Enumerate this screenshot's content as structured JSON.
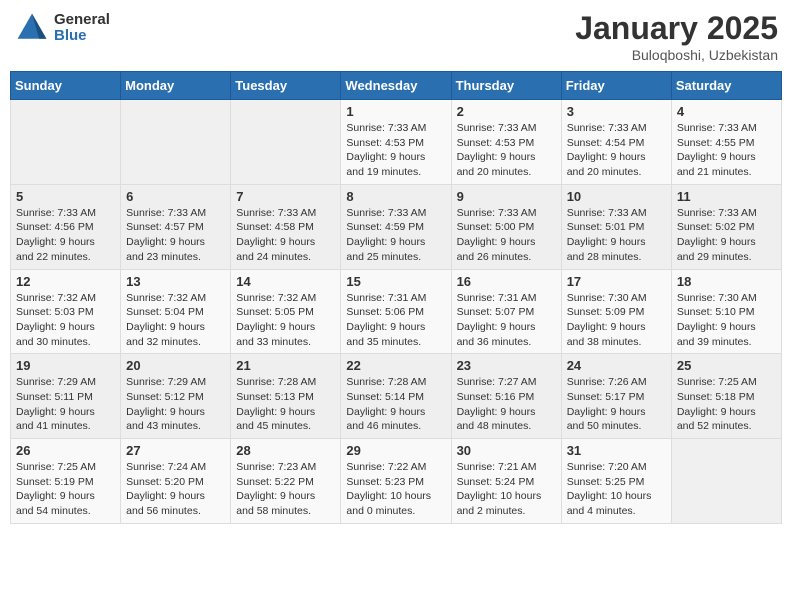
{
  "header": {
    "logo_general": "General",
    "logo_blue": "Blue",
    "title": "January 2025",
    "location": "Buloqboshi, Uzbekistan"
  },
  "weekdays": [
    "Sunday",
    "Monday",
    "Tuesday",
    "Wednesday",
    "Thursday",
    "Friday",
    "Saturday"
  ],
  "weeks": [
    [
      {
        "day": "",
        "info": ""
      },
      {
        "day": "",
        "info": ""
      },
      {
        "day": "",
        "info": ""
      },
      {
        "day": "1",
        "info": "Sunrise: 7:33 AM\nSunset: 4:53 PM\nDaylight: 9 hours\nand 19 minutes."
      },
      {
        "day": "2",
        "info": "Sunrise: 7:33 AM\nSunset: 4:53 PM\nDaylight: 9 hours\nand 20 minutes."
      },
      {
        "day": "3",
        "info": "Sunrise: 7:33 AM\nSunset: 4:54 PM\nDaylight: 9 hours\nand 20 minutes."
      },
      {
        "day": "4",
        "info": "Sunrise: 7:33 AM\nSunset: 4:55 PM\nDaylight: 9 hours\nand 21 minutes."
      }
    ],
    [
      {
        "day": "5",
        "info": "Sunrise: 7:33 AM\nSunset: 4:56 PM\nDaylight: 9 hours\nand 22 minutes."
      },
      {
        "day": "6",
        "info": "Sunrise: 7:33 AM\nSunset: 4:57 PM\nDaylight: 9 hours\nand 23 minutes."
      },
      {
        "day": "7",
        "info": "Sunrise: 7:33 AM\nSunset: 4:58 PM\nDaylight: 9 hours\nand 24 minutes."
      },
      {
        "day": "8",
        "info": "Sunrise: 7:33 AM\nSunset: 4:59 PM\nDaylight: 9 hours\nand 25 minutes."
      },
      {
        "day": "9",
        "info": "Sunrise: 7:33 AM\nSunset: 5:00 PM\nDaylight: 9 hours\nand 26 minutes."
      },
      {
        "day": "10",
        "info": "Sunrise: 7:33 AM\nSunset: 5:01 PM\nDaylight: 9 hours\nand 28 minutes."
      },
      {
        "day": "11",
        "info": "Sunrise: 7:33 AM\nSunset: 5:02 PM\nDaylight: 9 hours\nand 29 minutes."
      }
    ],
    [
      {
        "day": "12",
        "info": "Sunrise: 7:32 AM\nSunset: 5:03 PM\nDaylight: 9 hours\nand 30 minutes."
      },
      {
        "day": "13",
        "info": "Sunrise: 7:32 AM\nSunset: 5:04 PM\nDaylight: 9 hours\nand 32 minutes."
      },
      {
        "day": "14",
        "info": "Sunrise: 7:32 AM\nSunset: 5:05 PM\nDaylight: 9 hours\nand 33 minutes."
      },
      {
        "day": "15",
        "info": "Sunrise: 7:31 AM\nSunset: 5:06 PM\nDaylight: 9 hours\nand 35 minutes."
      },
      {
        "day": "16",
        "info": "Sunrise: 7:31 AM\nSunset: 5:07 PM\nDaylight: 9 hours\nand 36 minutes."
      },
      {
        "day": "17",
        "info": "Sunrise: 7:30 AM\nSunset: 5:09 PM\nDaylight: 9 hours\nand 38 minutes."
      },
      {
        "day": "18",
        "info": "Sunrise: 7:30 AM\nSunset: 5:10 PM\nDaylight: 9 hours\nand 39 minutes."
      }
    ],
    [
      {
        "day": "19",
        "info": "Sunrise: 7:29 AM\nSunset: 5:11 PM\nDaylight: 9 hours\nand 41 minutes."
      },
      {
        "day": "20",
        "info": "Sunrise: 7:29 AM\nSunset: 5:12 PM\nDaylight: 9 hours\nand 43 minutes."
      },
      {
        "day": "21",
        "info": "Sunrise: 7:28 AM\nSunset: 5:13 PM\nDaylight: 9 hours\nand 45 minutes."
      },
      {
        "day": "22",
        "info": "Sunrise: 7:28 AM\nSunset: 5:14 PM\nDaylight: 9 hours\nand 46 minutes."
      },
      {
        "day": "23",
        "info": "Sunrise: 7:27 AM\nSunset: 5:16 PM\nDaylight: 9 hours\nand 48 minutes."
      },
      {
        "day": "24",
        "info": "Sunrise: 7:26 AM\nSunset: 5:17 PM\nDaylight: 9 hours\nand 50 minutes."
      },
      {
        "day": "25",
        "info": "Sunrise: 7:25 AM\nSunset: 5:18 PM\nDaylight: 9 hours\nand 52 minutes."
      }
    ],
    [
      {
        "day": "26",
        "info": "Sunrise: 7:25 AM\nSunset: 5:19 PM\nDaylight: 9 hours\nand 54 minutes."
      },
      {
        "day": "27",
        "info": "Sunrise: 7:24 AM\nSunset: 5:20 PM\nDaylight: 9 hours\nand 56 minutes."
      },
      {
        "day": "28",
        "info": "Sunrise: 7:23 AM\nSunset: 5:22 PM\nDaylight: 9 hours\nand 58 minutes."
      },
      {
        "day": "29",
        "info": "Sunrise: 7:22 AM\nSunset: 5:23 PM\nDaylight: 10 hours\nand 0 minutes."
      },
      {
        "day": "30",
        "info": "Sunrise: 7:21 AM\nSunset: 5:24 PM\nDaylight: 10 hours\nand 2 minutes."
      },
      {
        "day": "31",
        "info": "Sunrise: 7:20 AM\nSunset: 5:25 PM\nDaylight: 10 hours\nand 4 minutes."
      },
      {
        "day": "",
        "info": ""
      }
    ]
  ]
}
